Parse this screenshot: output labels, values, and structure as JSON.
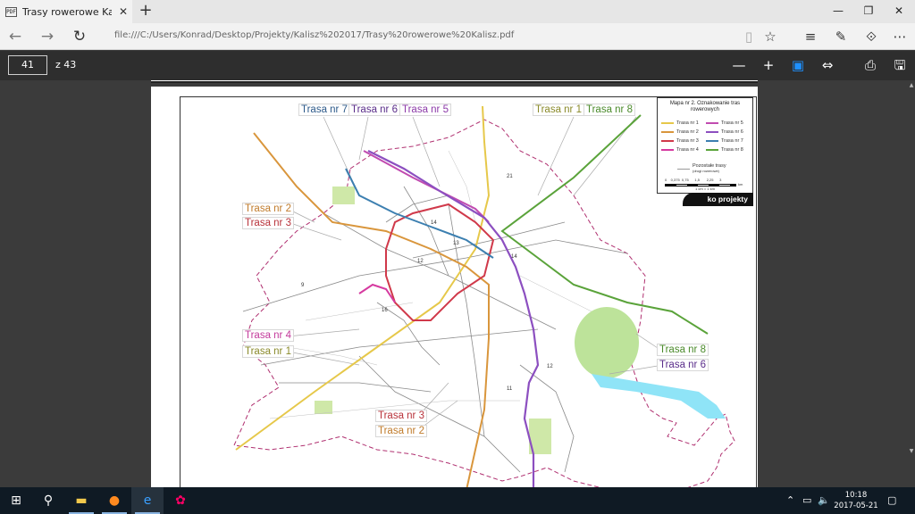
{
  "browser": {
    "tab_title": "Trasy rowerowe Kalisz.p",
    "tab_favicon": "pdf-icon",
    "url": "file:///C:/Users/Konrad/Desktop/Projekty/Kalisz%202017/Trasy%20rowerowe%20Kalisz.pdf"
  },
  "pdf_toolbar": {
    "page_number": "41",
    "page_total": "z 43"
  },
  "map": {
    "legend_title": "Mapa nr 2. Oznakowanie tras rowerowych",
    "legend_items": [
      {
        "label": "Trasa nr 1",
        "color": "#e6c84a"
      },
      {
        "label": "Trasa nr 5",
        "color": "#c14bb0"
      },
      {
        "label": "Trasa nr 2",
        "color": "#d9963c"
      },
      {
        "label": "Trasa nr 6",
        "color": "#8c4fc0"
      },
      {
        "label": "Trasa nr 3",
        "color": "#d0394a"
      },
      {
        "label": "Trasa nr 7",
        "color": "#3c7fb0"
      },
      {
        "label": "Trasa nr 4",
        "color": "#d63aa0"
      },
      {
        "label": "Trasa nr 8",
        "color": "#5aa33a"
      }
    ],
    "legend_other": "Pozostałe trasy",
    "legend_other_sub": "(drogi rowerowe)",
    "scale_ticks": "0    0,375  0,75      1,5       2,25      3",
    "scale_unit": "km",
    "scale_ratio": "1 cm = 1 km",
    "brand": "ko projekty",
    "labels": {
      "trasa7_top": "Trasa nr 7",
      "trasa6_top": "Trasa nr 6",
      "trasa5_top": "Trasa nr 5",
      "trasa1_top": "Trasa nr 1",
      "trasa8_top": "Trasa nr 8",
      "trasa2_left": "Trasa nr 2",
      "trasa3_left": "Trasa nr 3",
      "trasa4_left": "Trasa nr 4",
      "trasa1_left": "Trasa nr 1",
      "trasa8_right": "Trasa nr 8",
      "trasa6_right": "Trasa nr 6",
      "trasa3_bottom": "Trasa nr 3",
      "trasa2_bottom": "Trasa nr 2"
    }
  },
  "taskbar": {
    "time": "10:18",
    "date": "2017-05-21"
  }
}
